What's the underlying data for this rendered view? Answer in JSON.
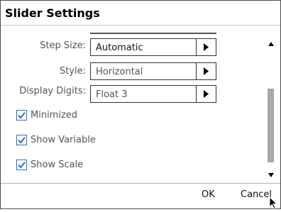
{
  "dialog": {
    "title": "Slider Settings"
  },
  "fields": {
    "step_size": {
      "label": "Step Size:",
      "value": "Automatic"
    },
    "style": {
      "label": "Style:",
      "value": "Horizontal"
    },
    "display_digits": {
      "label": "Display Digits:",
      "value": "Float 3"
    }
  },
  "options": {
    "minimized": {
      "label": "Minimized",
      "checked": true
    },
    "show_variable": {
      "label": "Show Variable",
      "checked": true
    },
    "show_scale": {
      "label": "Show Scale",
      "checked": true
    }
  },
  "buttons": {
    "ok": "OK",
    "cancel": "Cancel"
  },
  "colors": {
    "checkbox_accent": "#2a6fc9",
    "scroll_thumb": "#a8a8a8"
  }
}
